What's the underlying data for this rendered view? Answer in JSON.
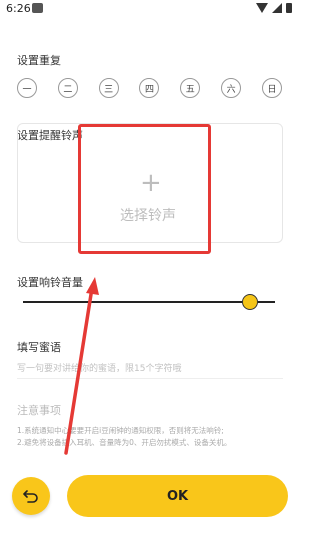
{
  "status_bar": {
    "time": "6:26"
  },
  "repeat": {
    "title": "设置重复",
    "days": [
      "一",
      "二",
      "三",
      "四",
      "五",
      "六",
      "日"
    ]
  },
  "ringtone": {
    "title": "设置提醒铃声",
    "plus": "+",
    "select_label": "选择铃声"
  },
  "volume": {
    "title": "设置响铃音量",
    "level": 0.9
  },
  "message": {
    "title": "填写蜜语",
    "placeholder": "写一句要对讲给你的蜜语，限15个字符哦"
  },
  "notes": {
    "title": "注意事项",
    "line1": "1.系统通知中心要要开启i豆闹钟的通知权限，否则将无法响铃;",
    "line2": "2.避免将设备插入耳机、音量降为0、开启勿扰模式、设备关机。"
  },
  "buttons": {
    "ok_label": "OK"
  },
  "colors": {
    "accent": "#f9c61a",
    "annotation": "#e53935"
  }
}
